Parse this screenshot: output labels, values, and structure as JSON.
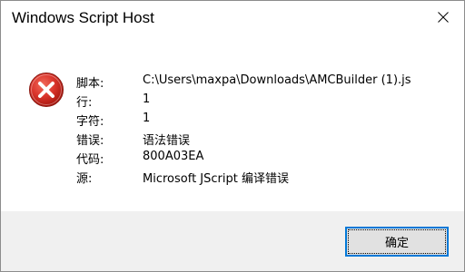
{
  "window": {
    "title": "Windows Script Host"
  },
  "icons": {
    "close": "close-icon",
    "error": "error-icon"
  },
  "details": [
    {
      "label": "脚本:",
      "value": "C:\\Users\\maxpa\\Downloads\\AMCBuilder (1).js"
    },
    {
      "label": "行:",
      "value": "1"
    },
    {
      "label": "字符:",
      "value": "1"
    },
    {
      "label": "错误:",
      "value": "语法错误"
    },
    {
      "label": "代码:",
      "value": "800A03EA"
    },
    {
      "label": "源:",
      "value": "Microsoft JScript 编译错误"
    }
  ],
  "buttons": {
    "ok_label": "确定"
  },
  "colors": {
    "error_red": "#c42b1c",
    "focus_blue": "#0078d7",
    "footer_bg": "#f0f0f0"
  }
}
